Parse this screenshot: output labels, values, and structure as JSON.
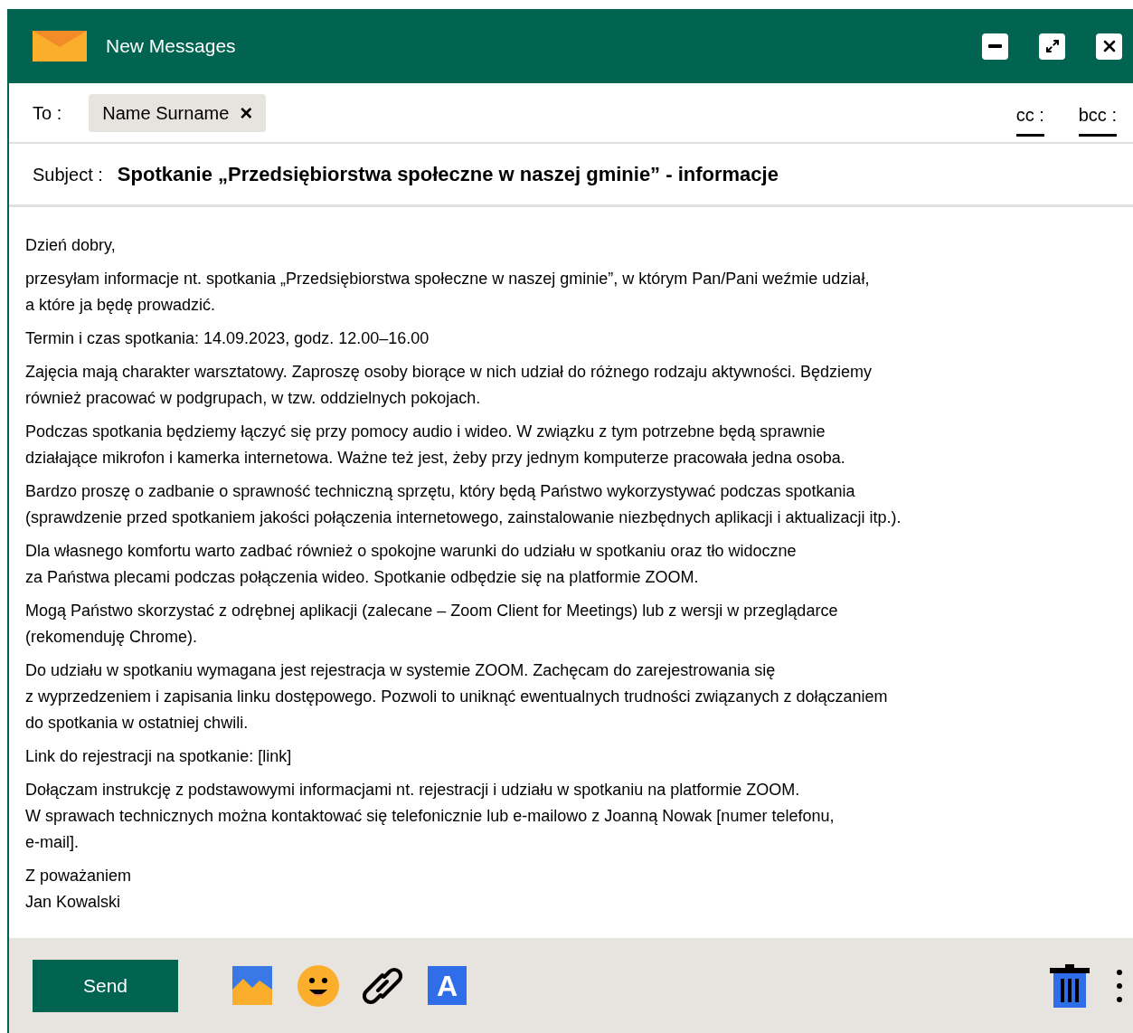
{
  "window": {
    "title": "New Messages"
  },
  "to": {
    "label": "To :",
    "recipients": [
      {
        "name": "Name Surname",
        "remove": "×"
      }
    ]
  },
  "cc": "cc :",
  "bcc": "bcc :",
  "subject": {
    "label": "Subject :",
    "value": "Spotkanie „Przedsiębiorstwa społeczne w naszej gminie” - informacje"
  },
  "body": [
    [
      "Dzień dobry,"
    ],
    [
      "przesyłam informacje nt. spotkania „Przedsiębiorstwa społeczne w naszej gminie”, w którym Pan/Pani weźmie udział,",
      "a które ja będę prowadzić."
    ],
    [
      "Termin i czas spotkania: 14.09.2023, godz. 12.00–16.00"
    ],
    [
      "Zajęcia mają charakter warsztatowy. Zaproszę osoby biorące w nich udział do różnego rodzaju aktywności. Będziemy",
      "również pracować w podgrupach, w tzw. oddzielnych pokojach."
    ],
    [
      "Podczas spotkania będziemy łączyć się przy pomocy audio i wideo. W związku z tym potrzebne będą sprawnie",
      "działające mikrofon i kamerka internetowa. Ważne też jest, żeby przy jednym komputerze pracowała jedna osoba."
    ],
    [
      "Bardzo proszę o zadbanie o sprawność techniczną sprzętu, który będą Państwo wykorzystywać podczas spotkania",
      "(sprawdzenie przed spotkaniem jakości połączenia internetowego, zainstalowanie niezbędnych aplikacji i aktualizacji itp.)."
    ],
    [
      "Dla własnego komfortu warto zadbać również o spokojne warunki do udziału w spotkaniu oraz tło widoczne",
      "za Państwa plecami podczas połączenia wideo. Spotkanie odbędzie się na platformie ZOOM."
    ],
    [
      "Mogą Państwo skorzystać z odrębnej aplikacji (zalecane – Zoom Client for Meetings) lub z wersji w przeglądarce",
      "(rekomenduję Chrome)."
    ],
    [
      "Do udziału w spotkaniu wymagana jest rejestracja w systemie ZOOM. Zachęcam do zarejestrowania się",
      "z wyprzedzeniem i zapisania linku dostępowego. Pozwoli to uniknąć ewentualnych trudności związanych z dołączaniem",
      "do spotkania w ostatniej chwili."
    ],
    [
      "Link do rejestracji na spotkanie: [link]"
    ],
    [
      "Dołączam instrukcję z podstawowymi informacjami nt. rejestracji i udziału w spotkaniu na platformie ZOOM.",
      "W sprawach technicznych można kontaktować się telefonicznie lub e-mailowo z Joanną Nowak [numer telefonu,",
      "e-mail]."
    ],
    [
      "Z poważaniem",
      "Jan Kowalski"
    ]
  ],
  "footer": {
    "send": "Send",
    "format_letter": "A"
  }
}
